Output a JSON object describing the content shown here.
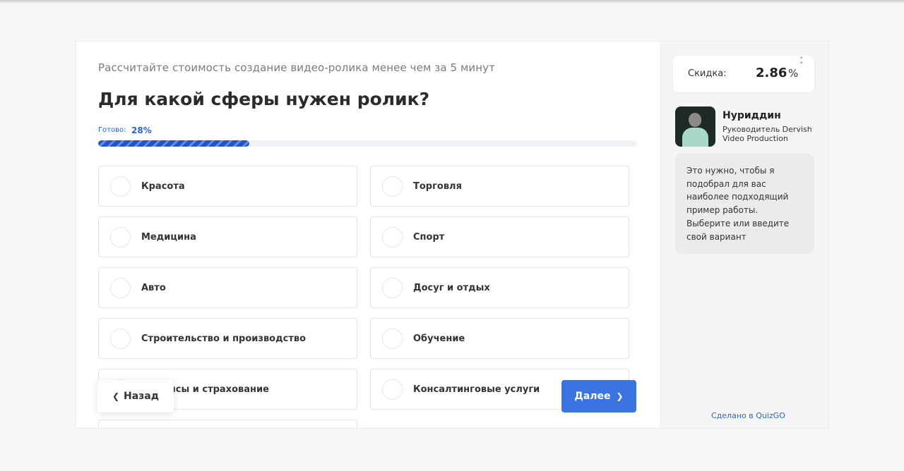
{
  "quiz": {
    "subtitle": "Рассчитайте стоимость создание видео-ролика менее чем за 5 минут",
    "question": "Для какой сферы нужен ролик?",
    "progress": {
      "label": "Готово:",
      "value_text": "28%",
      "value": 0.28
    },
    "options": [
      "Красота",
      "Торговля",
      "Медицина",
      "Спорт",
      "Авто",
      "Досуг и отдых",
      "Строительство и производство",
      "Обучение",
      "Финансы и страхование",
      "Консалтинговые услуги"
    ],
    "buttons": {
      "back": "Назад",
      "next": "Далее"
    }
  },
  "sidebar": {
    "discount": {
      "label": "Скидка:",
      "value": "2.86",
      "unit": "%"
    },
    "manager": {
      "name": "Нуриддин",
      "role": "Руководитель Dervish Video Production"
    },
    "message": [
      "Это нужно, чтобы я подобрал для вас наиболее подходящий пример работы.",
      "Выберите или введите свой вариант"
    ],
    "made_in": "Сделано в QuizGO"
  },
  "colors": {
    "accent": "#3b74e0",
    "progress": "#1f56c9",
    "discount_arrow": "#2fb24a"
  }
}
